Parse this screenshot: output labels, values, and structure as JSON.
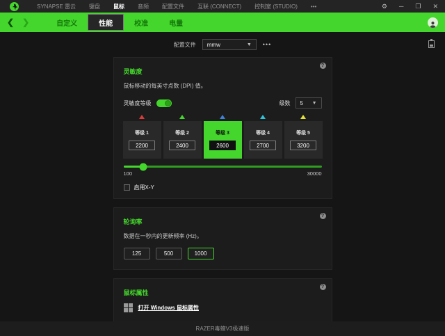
{
  "colors": {
    "accent": "#44d62c"
  },
  "icons": {
    "gear": "⚙",
    "minimize": "─",
    "maximize": "❒",
    "close": "✕",
    "back": "❮",
    "forward": "❯",
    "dropdown": "▼",
    "help": "?",
    "more": "•••"
  },
  "titlebar": {
    "menu": [
      {
        "label": "SYNAPSE 雷云",
        "active": false
      },
      {
        "label": "键盘",
        "active": false
      },
      {
        "label": "鼠标",
        "active": true
      },
      {
        "label": "音频",
        "active": false
      },
      {
        "label": "配置文件",
        "active": false
      },
      {
        "label": "互联 (CONNECT)",
        "active": false
      },
      {
        "label": "控制室 (STUDIO)",
        "active": false
      },
      {
        "label": "•••",
        "active": false
      }
    ]
  },
  "nav": {
    "tabs": [
      {
        "label": "自定义",
        "active": false
      },
      {
        "label": "性能",
        "active": true
      },
      {
        "label": "校准",
        "active": false
      },
      {
        "label": "电量",
        "active": false
      }
    ]
  },
  "profile": {
    "label": "配置文件",
    "value": "mmw",
    "more": "•••"
  },
  "sensitivity": {
    "title": "灵敏度",
    "subtitle": "鼠标移动的每英寸点数 (DPI) 值。",
    "stages_toggle_label": "灵敏度等级",
    "stages_toggle_on": true,
    "stages_count_label": "级数",
    "stages_count_value": "5",
    "stages": [
      {
        "label": "等级 1",
        "value": "2200",
        "marker_color": "#d93b3b",
        "active": false
      },
      {
        "label": "等级 2",
        "value": "2400",
        "marker_color": "#44d62c",
        "active": false
      },
      {
        "label": "等级 3",
        "value": "2600",
        "marker_color": "#3f7fd6",
        "active": true
      },
      {
        "label": "等级 4",
        "value": "2700",
        "marker_color": "#2fc2d9",
        "active": false
      },
      {
        "label": "等级 5",
        "value": "3200",
        "marker_color": "#e3e23a",
        "active": false
      }
    ],
    "slider": {
      "min": 100,
      "max": 30000,
      "value": 2600,
      "min_label": "100",
      "max_label": "30000"
    },
    "xy_checkbox_label": "启用X-Y",
    "xy_checkbox_checked": false
  },
  "polling": {
    "title": "轮询率",
    "subtitle": "数据在一秒内的更新频率 (Hz)。",
    "options": [
      {
        "label": "125",
        "active": false
      },
      {
        "label": "500",
        "active": false
      },
      {
        "label": "1000",
        "active": true
      }
    ]
  },
  "mouse_props": {
    "title": "鼠标属性",
    "link": "打开 Windows 鼠标属性"
  },
  "footer": {
    "device": "RAZER毒蝰V3极速版"
  }
}
